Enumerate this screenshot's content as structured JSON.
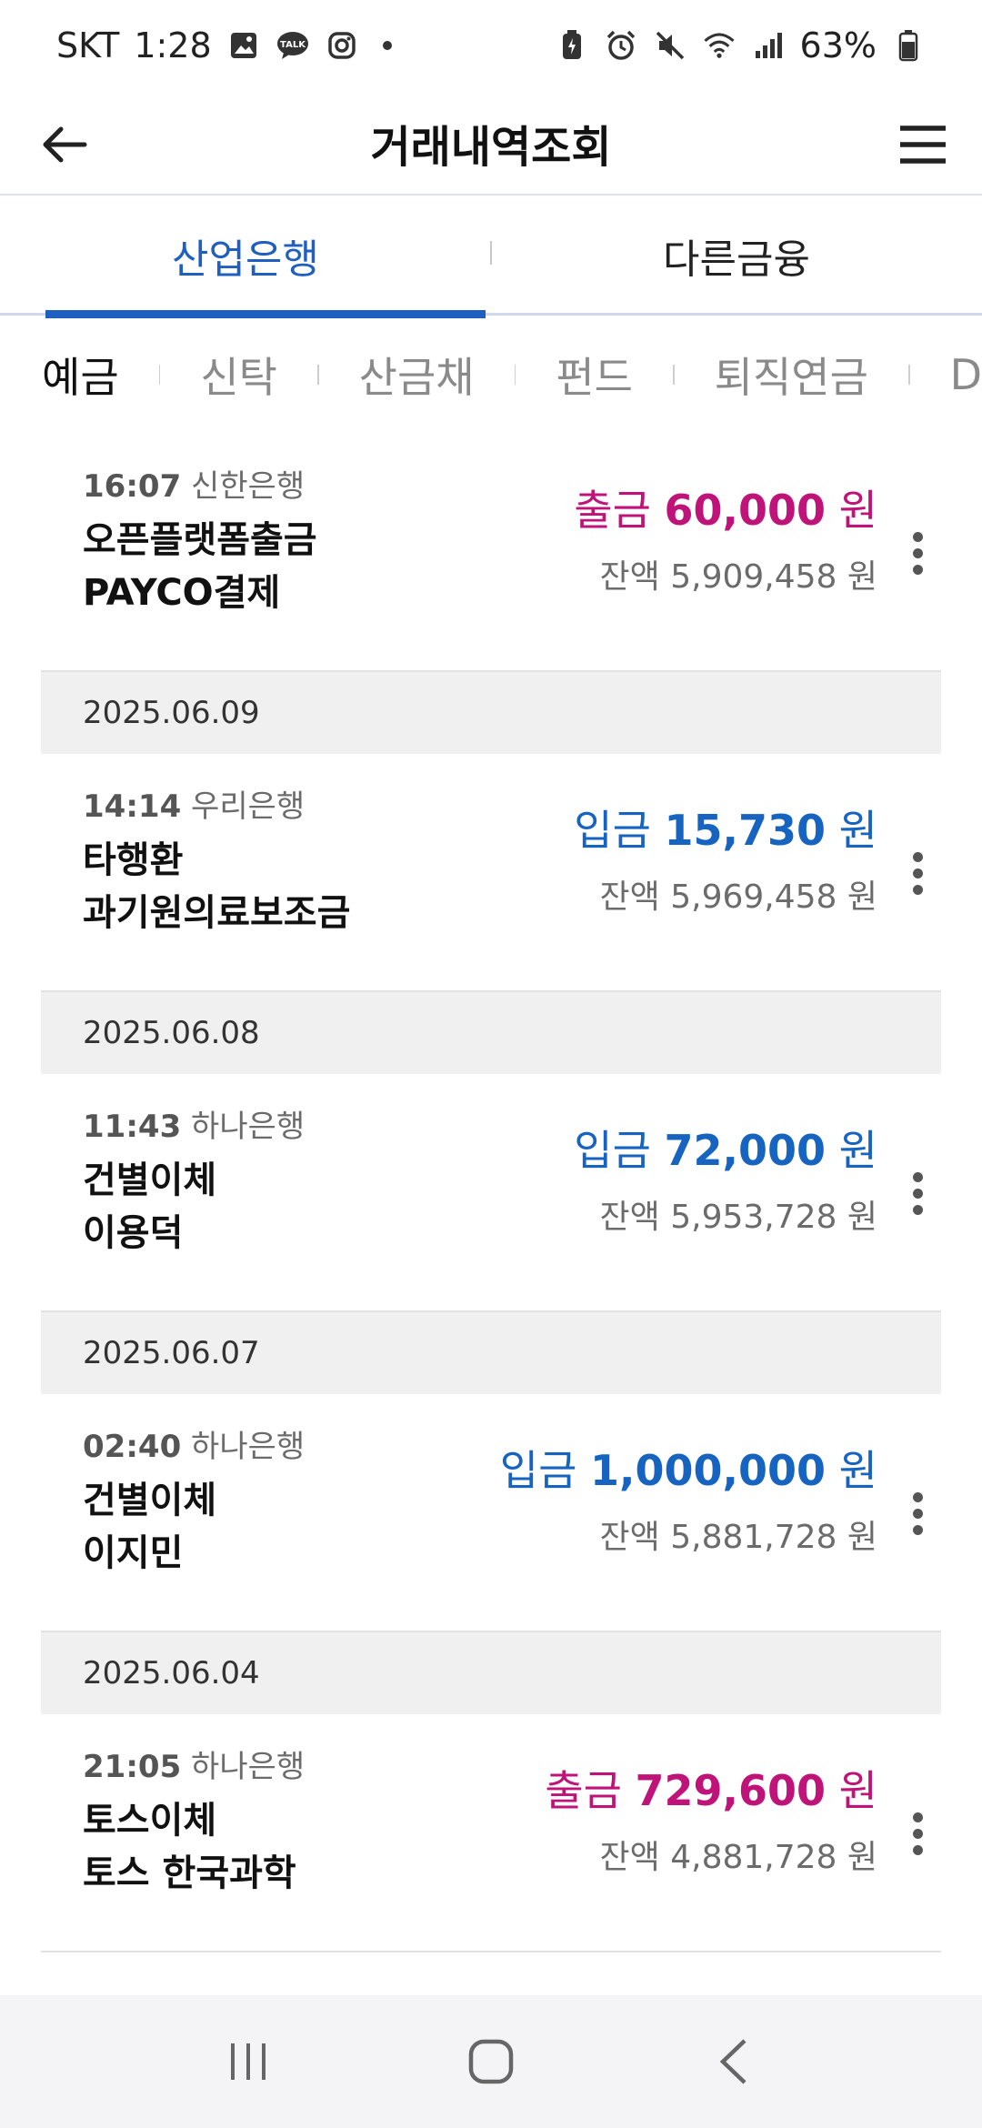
{
  "status_bar": {
    "carrier": "SKT",
    "time": "1:28",
    "battery": "63%",
    "icons_left": [
      "gallery-icon",
      "kakaotalk-icon",
      "instagram-icon"
    ],
    "icons_right": [
      "battery-saver-icon",
      "alarm-icon",
      "mute-icon",
      "wifi-icon",
      "signal-icon",
      "battery-icon"
    ]
  },
  "header": {
    "title": "거래내역조회"
  },
  "bank_tabs": [
    {
      "label": "산업은행",
      "active": true
    },
    {
      "label": "다른금융",
      "active": false
    }
  ],
  "product_tabs": [
    {
      "label": "예금",
      "active": true
    },
    {
      "label": "신탁",
      "active": false
    },
    {
      "label": "산금채",
      "active": false
    },
    {
      "label": "펀드",
      "active": false
    },
    {
      "label": "퇴직연금",
      "active": false
    },
    {
      "label": "D",
      "active": false
    }
  ],
  "transactions": [
    {
      "time": "16:07",
      "bank": "신한은행",
      "desc1": "오픈플랫폼출금",
      "desc2": "PAYCO결제",
      "type": "출금",
      "amount": "60,000",
      "unit": "원",
      "balance_label": "잔액",
      "balance": "5,909,458 원",
      "direction": "out"
    },
    {
      "date": "2025.06.09"
    },
    {
      "time": "14:14",
      "bank": "우리은행",
      "desc1": "타행환",
      "desc2": "과기원의료보조금",
      "type": "입금",
      "amount": "15,730",
      "unit": "원",
      "balance_label": "잔액",
      "balance": "5,969,458 원",
      "direction": "in"
    },
    {
      "date": "2025.06.08"
    },
    {
      "time": "11:43",
      "bank": "하나은행",
      "desc1": "건별이체",
      "desc2": "이용덕",
      "type": "입금",
      "amount": "72,000",
      "unit": "원",
      "balance_label": "잔액",
      "balance": "5,953,728 원",
      "direction": "in"
    },
    {
      "date": "2025.06.07"
    },
    {
      "time": "02:40",
      "bank": "하나은행",
      "desc1": "건별이체",
      "desc2": "이지민",
      "type": "입금",
      "amount": "1,000,000",
      "unit": "원",
      "balance_label": "잔액",
      "balance": "5,881,728 원",
      "direction": "in"
    },
    {
      "date": "2025.06.04"
    },
    {
      "time": "21:05",
      "bank": "하나은행",
      "desc1": "토스이체",
      "desc2": "토스 한국과학",
      "type": "출금",
      "amount": "729,600",
      "unit": "원",
      "balance_label": "잔액",
      "balance": "4,881,728 원",
      "direction": "out"
    }
  ],
  "nav_bar": [
    "recent-apps-icon",
    "home-icon",
    "back-icon"
  ],
  "colors": {
    "accent": "#1f5fbf",
    "deposit": "#1664c0",
    "withdrawal": "#c0137a"
  }
}
